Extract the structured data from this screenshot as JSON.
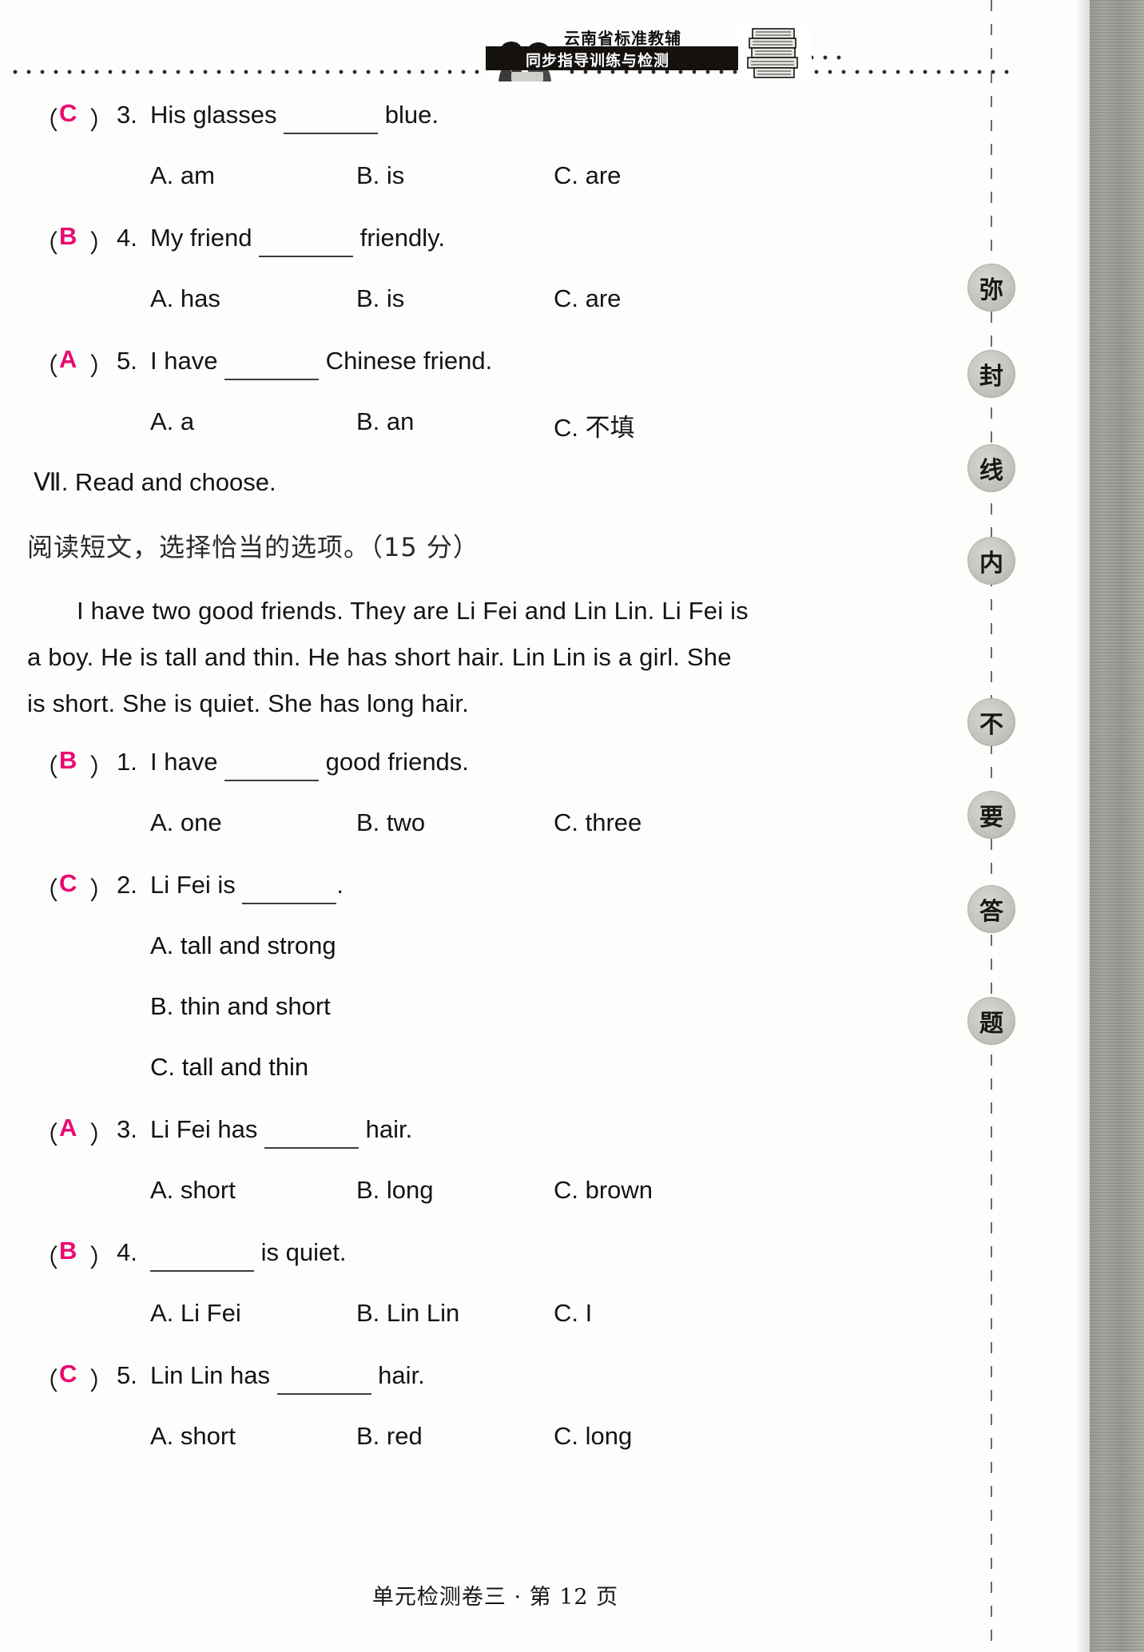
{
  "header": {
    "brand_top": "云南省标准教辅",
    "brand_bar": "同步指导训练与检测",
    "students_icon": "two-students-illustration",
    "books_icon": "stack-of-books-illustration"
  },
  "seal_margin": {
    "chars": [
      "弥",
      "封",
      "线",
      "内",
      "不",
      "要",
      "答",
      "题"
    ]
  },
  "answer_color": "#ea0a6e",
  "section_six_tail": {
    "questions": [
      {
        "answer": "C",
        "number": "3.",
        "stem_before": "His glasses",
        "stem_after": "blue.",
        "options": [
          "A.  am",
          "B.  is",
          "C.  are"
        ]
      },
      {
        "answer": "B",
        "number": "4.",
        "stem_before": "My friend",
        "stem_after": "friendly.",
        "options": [
          "A.  has",
          "B.  is",
          "C.  are"
        ]
      },
      {
        "answer": "A",
        "number": "5.",
        "stem_before": "I have",
        "stem_after": "Chinese friend.",
        "options": [
          "A.  a",
          "B.  an",
          "C.  不填"
        ]
      }
    ]
  },
  "section_seven": {
    "title": "Ⅶ.  Read and choose.",
    "subtitle": "阅读短文，选择恰当的选项。（15 分）",
    "passage": "I have two good friends.  They are Li Fei and Lin Lin.  Li Fei is a boy.  He is tall and thin.  He has short hair.  Lin Lin is a girl.  She is short.  She is quiet.  She has long hair.",
    "questions": [
      {
        "answer": "B",
        "number": "1.",
        "stem_before": "I have",
        "stem_after": "good friends.",
        "layout": "inline",
        "options": [
          "A.  one",
          "B.  two",
          "C.  three"
        ]
      },
      {
        "answer": "C",
        "number": "2.",
        "stem_before": "Li Fei is",
        "stem_after": ".",
        "layout": "stacked",
        "options": [
          "A.  tall and strong",
          "B.  thin and short",
          "C.  tall and thin"
        ]
      },
      {
        "answer": "A",
        "number": "3.",
        "stem_before": "Li Fei has",
        "stem_after": "hair.",
        "layout": "inline",
        "options": [
          "A.  short",
          "B.  long",
          "C.  brown"
        ]
      },
      {
        "answer": "B",
        "number": "4.",
        "stem_before": "",
        "stem_after": "is quiet.",
        "layout": "inline",
        "options": [
          "A.  Li Fei",
          "B.  Lin Lin",
          "C.  I"
        ]
      },
      {
        "answer": "C",
        "number": "5.",
        "stem_before": "Lin Lin has",
        "stem_after": "hair.",
        "layout": "inline",
        "options": [
          "A.  short",
          "B.  red",
          "C.  long"
        ]
      }
    ]
  },
  "footer": {
    "text": "单元检测卷三 · 第 12 页"
  }
}
